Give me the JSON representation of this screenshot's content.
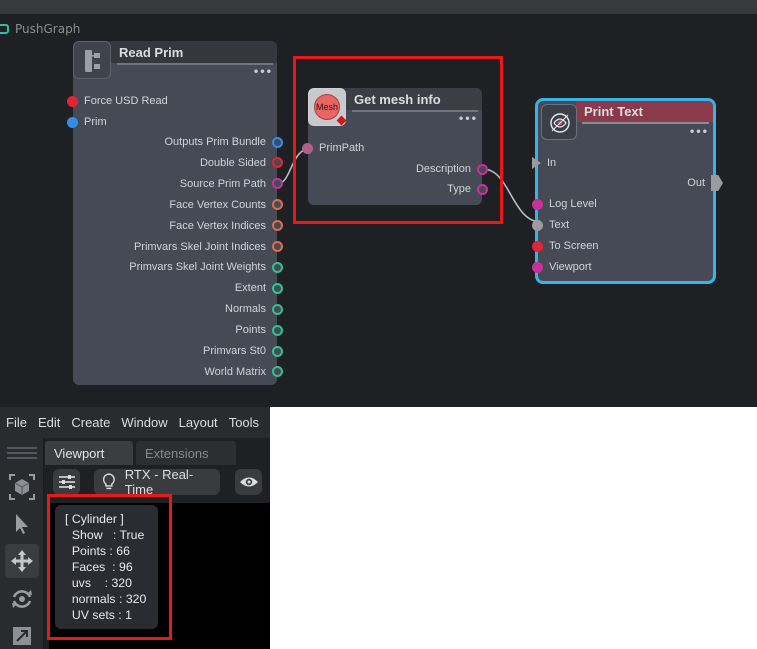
{
  "graph": {
    "tab_title": "PushGraph",
    "menu_dots": "•••",
    "nodes": {
      "read_prim": {
        "title": "Read Prim",
        "inputs": [
          "Force USD Read",
          "Prim"
        ],
        "outputs": [
          "Outputs Prim Bundle",
          "Double Sided",
          "Source Prim Path",
          "Face Vertex Counts",
          "Face Vertex Indices",
          "Primvars Skel Joint Indices",
          "Primvars Skel Joint Weights",
          "Extent",
          "Normals",
          "Points",
          "Primvars St0",
          "World Matrix"
        ]
      },
      "get_mesh_info": {
        "title": "Get mesh info",
        "icon_text": "Mesh",
        "inputs": [
          "PrimPath"
        ],
        "outputs": [
          "Description",
          "Type"
        ]
      },
      "print_text": {
        "title": "Print Text",
        "inputs": [
          "In",
          "Log Level",
          "Text",
          "To Screen",
          "Viewport"
        ],
        "outputs": [
          "Out"
        ]
      }
    },
    "colors": {
      "accent_red": "#e8191b",
      "selection_blue": "#34b4e8",
      "pin_red": "#e0243a",
      "pin_blue": "#2f8fe8",
      "pin_magenta": "#c8309a",
      "pin_salmon": "#e06a52",
      "pin_green": "#2ec48e"
    }
  },
  "app": {
    "menu": [
      "File",
      "Edit",
      "Create",
      "Window",
      "Layout",
      "Tools"
    ],
    "tabs": [
      "Viewport",
      "Extensions"
    ],
    "renderer_label": "RTX - Real-Time",
    "info_lines": [
      "[ Cylinder ]",
      "  Show   : True",
      "  Points : 66",
      "  Faces  : 96",
      "  uvs    : 320",
      "  normals : 320",
      "  UV sets : 1"
    ],
    "icons": [
      "settings-sliders-icon",
      "lightbulb-icon",
      "eye-icon",
      "cube-icon",
      "select-arrow-icon",
      "move-icon",
      "rotate-icon",
      "scale-icon"
    ]
  }
}
